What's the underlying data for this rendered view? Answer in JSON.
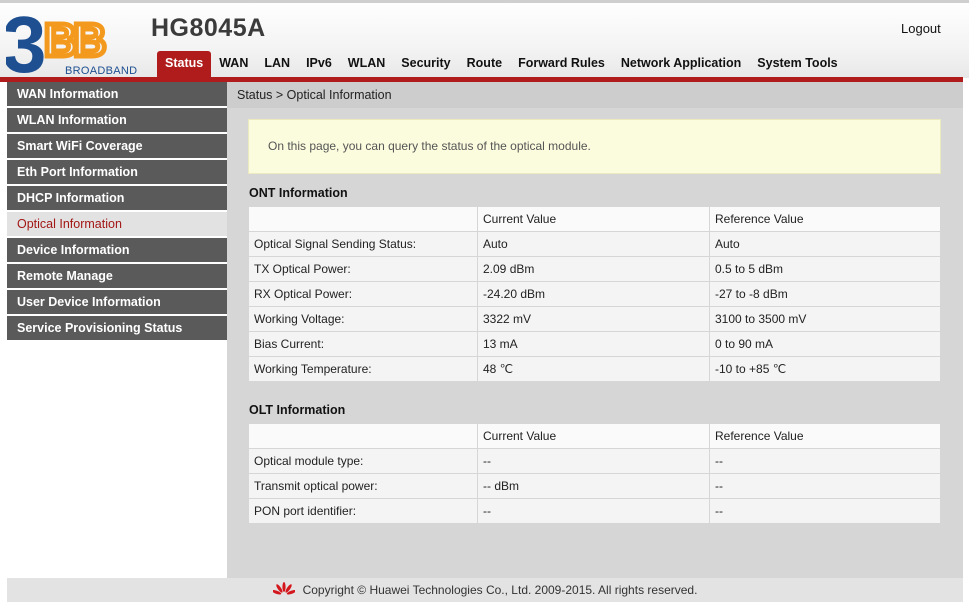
{
  "header": {
    "logo_brand": "BROADBAND",
    "logo_mark": "3BB",
    "model": "HG8045A",
    "logout_label": "Logout",
    "nav": [
      "Status",
      "WAN",
      "LAN",
      "IPv6",
      "WLAN",
      "Security",
      "Route",
      "Forward Rules",
      "Network Application",
      "System Tools"
    ],
    "active_nav": "Status"
  },
  "sidebar": {
    "items": [
      "WAN Information",
      "WLAN Information",
      "Smart WiFi Coverage",
      "Eth Port Information",
      "DHCP Information",
      "Optical Information",
      "Device Information",
      "Remote Manage",
      "User Device Information",
      "Service Provisioning Status"
    ],
    "active": "Optical Information"
  },
  "main": {
    "breadcrumb": "Status > Optical Information",
    "notice": "On this page, you can query the status of the optical module.",
    "ont": {
      "title": "ONT Information",
      "headers": [
        "",
        "Current Value",
        "Reference Value"
      ],
      "rows": [
        [
          "Optical Signal Sending Status:",
          "Auto",
          "Auto"
        ],
        [
          "TX Optical Power:",
          "2.09 dBm",
          "0.5 to 5 dBm"
        ],
        [
          "RX Optical Power:",
          "-24.20 dBm",
          "-27 to -8 dBm"
        ],
        [
          "Working Voltage:",
          "3322 mV",
          "3100 to 3500 mV"
        ],
        [
          "Bias Current:",
          "13 mA",
          "0 to 90 mA"
        ],
        [
          "Working Temperature:",
          "48 ℃",
          "-10 to +85 ℃"
        ]
      ]
    },
    "olt": {
      "title": "OLT Information",
      "headers": [
        "",
        "Current Value",
        "Reference Value"
      ],
      "rows": [
        [
          "Optical module type:",
          "--",
          "--"
        ],
        [
          "Transmit optical power:",
          "-- dBm",
          "--"
        ],
        [
          "PON port identifier:",
          "--",
          "--"
        ]
      ]
    }
  },
  "footer": {
    "copyright": "Copyright © Huawei Technologies Co., Ltd. 2009-2015. All rights reserved."
  },
  "colors": {
    "brand_red": "#b01c1c",
    "logo_blue": "#1d4f91",
    "logo_orange": "#f39a1e",
    "sidebar_bg": "#5a5a5a",
    "notice_bg": "#fbfbde"
  },
  "icons": {
    "footer_logo": "huawei-logo-icon"
  }
}
